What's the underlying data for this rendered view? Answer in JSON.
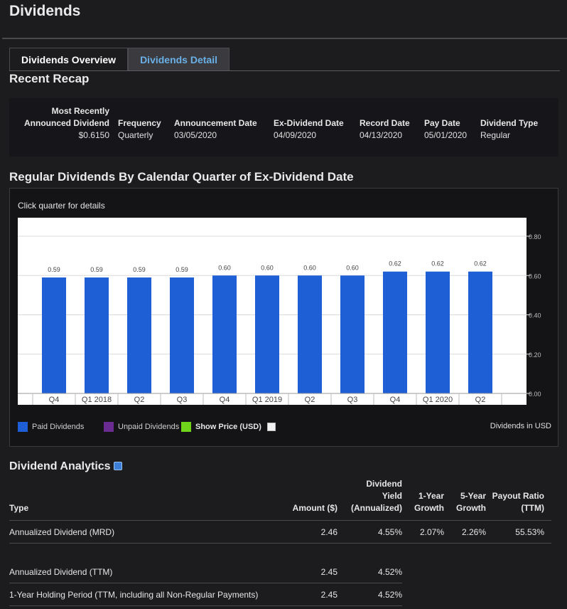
{
  "page": {
    "title": "Dividends"
  },
  "tabs": [
    {
      "label": "Dividends Overview",
      "active": false
    },
    {
      "label": "Dividends Detail",
      "active": true
    }
  ],
  "recap": {
    "heading": "Recent Recap",
    "columns": [
      {
        "label_lines": [
          "Most Recently",
          "Announced Dividend"
        ],
        "value": "$0.6150"
      },
      {
        "label_lines": [
          "Frequency"
        ],
        "value": "Quarterly"
      },
      {
        "label_lines": [
          "Announcement Date"
        ],
        "value": "03/05/2020"
      },
      {
        "label_lines": [
          "Ex-Dividend Date"
        ],
        "value": "04/09/2020"
      },
      {
        "label_lines": [
          "Record Date"
        ],
        "value": "04/13/2020"
      },
      {
        "label_lines": [
          "Pay Date"
        ],
        "value": "05/01/2020"
      },
      {
        "label_lines": [
          "Dividend Type"
        ],
        "value": "Regular"
      }
    ]
  },
  "chart_section": {
    "heading": "Regular Dividends By Calendar Quarter of Ex-Dividend Date",
    "hint": "Click quarter for details",
    "currency_note": "Dividends in USD",
    "legend": [
      {
        "label": "Paid Dividends",
        "color": "#1f5fd6"
      },
      {
        "label": "Unpaid Dividends",
        "color": "#6a2c91"
      },
      {
        "label": "Show Price (USD)",
        "color": "#6fd41a"
      }
    ]
  },
  "chart_data": {
    "type": "bar",
    "categories": [
      "Q4",
      "Q1 2018",
      "Q2",
      "Q3",
      "Q4",
      "Q1 2019",
      "Q2",
      "Q3",
      "Q4",
      "Q1 2020",
      "Q2"
    ],
    "values": [
      0.59,
      0.59,
      0.59,
      0.59,
      0.6,
      0.6,
      0.6,
      0.6,
      0.62,
      0.62,
      0.62
    ],
    "data_labels": [
      "0.59",
      "0.59",
      "0.59",
      "0.59",
      "0.60",
      "0.60",
      "0.60",
      "0.60",
      "0.62",
      "0.62",
      "0.62"
    ],
    "y_ticks": [
      "0.80",
      "0.60",
      "0.40",
      "0.20",
      "0.00"
    ],
    "ylim": [
      0,
      0.8
    ],
    "bar_color": "#1f5fd6",
    "grid": true
  },
  "analytics": {
    "heading": "Dividend Analytics",
    "headers": [
      {
        "lines": [
          "Type"
        ]
      },
      {
        "lines": [
          "Amount ($)"
        ]
      },
      {
        "lines": [
          "Dividend",
          "Yield",
          "(Annualized)"
        ]
      },
      {
        "lines": [
          "1-Year",
          "Growth"
        ]
      },
      {
        "lines": [
          "5-Year",
          "Growth"
        ]
      },
      {
        "lines": [
          "Payout Ratio",
          "(TTM)"
        ]
      }
    ],
    "rows": [
      {
        "type": "Annualized Dividend (MRD)",
        "amount": "2.46",
        "yield": "4.55%",
        "growth1": "2.07%",
        "growth5": "2.26%",
        "payout": "55.53%"
      },
      {
        "type": "Annualized Dividend (TTM)",
        "amount": "2.45",
        "yield": "4.52%"
      },
      {
        "type": "1-Year Holding Period (TTM, including all Non-Regular Payments)",
        "amount": "2.45",
        "yield": "4.52%"
      }
    ]
  }
}
